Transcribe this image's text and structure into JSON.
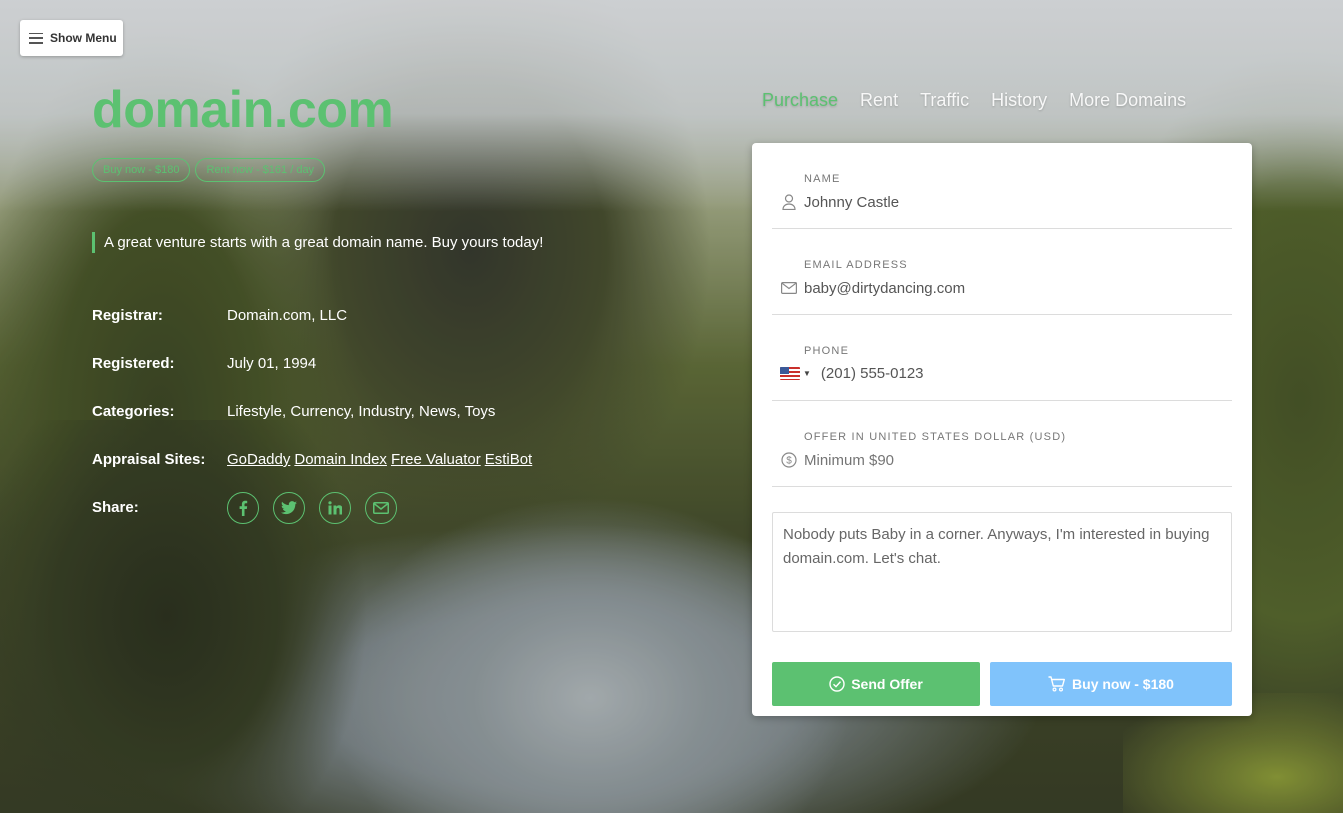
{
  "menu": {
    "label": "Show Menu"
  },
  "nav": {
    "items": [
      {
        "label": "Purchase",
        "active": true
      },
      {
        "label": "Rent",
        "active": false
      },
      {
        "label": "Traffic",
        "active": false
      },
      {
        "label": "History",
        "active": false
      },
      {
        "label": "More Domains",
        "active": false
      }
    ]
  },
  "hero": {
    "domain": "domain.com",
    "buy_pill": "Buy now - $180",
    "rent_pill": "Rent now - $161 / day",
    "tagline": "A great venture starts with a great domain name. Buy yours today!"
  },
  "details": {
    "registrar_label": "Registrar:",
    "registrar_value": "Domain.com, LLC",
    "registered_label": "Registered:",
    "registered_value": "July 01, 1994",
    "categories_label": "Categories:",
    "categories_value": "Lifestyle, Currency, Industry, News, Toys",
    "appraisal_label": "Appraisal Sites:",
    "appraisal_sites": [
      "GoDaddy",
      "Domain Index",
      "Free Valuator",
      "EstiBot"
    ],
    "share_label": "Share:",
    "share_icons": [
      "facebook-icon",
      "twitter-icon",
      "linkedin-icon",
      "email-icon"
    ]
  },
  "form": {
    "name_label": "Name",
    "name_value": "Johnny Castle",
    "email_label": "Email Address",
    "email_value": "baby@dirtydancing.com",
    "phone_label": "Phone",
    "phone_value": "(201) 555-0123",
    "offer_label": "Offer in United States Dollar (USD)",
    "offer_placeholder": "Minimum $90",
    "message": "Nobody puts Baby in a corner. Anyways, I'm interested in buying domain.com. Let's chat.",
    "send_label": "Send Offer",
    "buy_label": "Buy now - $180"
  },
  "colors": {
    "accent": "#5cc171",
    "buy_button": "#80c3fb"
  }
}
